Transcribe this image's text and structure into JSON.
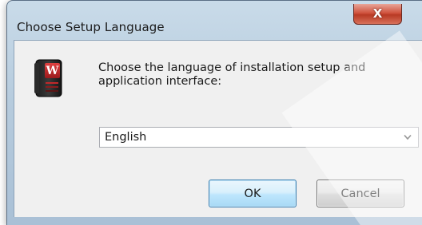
{
  "window": {
    "title": "Choose Setup Language",
    "close_glyph": "X"
  },
  "app_icon": {
    "name": "app-icon",
    "letter": "W",
    "accent": "#c0282a"
  },
  "prompt": "Choose the language of installation setup and application interface:",
  "language_select": {
    "selected": "English"
  },
  "buttons": {
    "ok_label": "OK",
    "cancel_label": "Cancel"
  }
}
